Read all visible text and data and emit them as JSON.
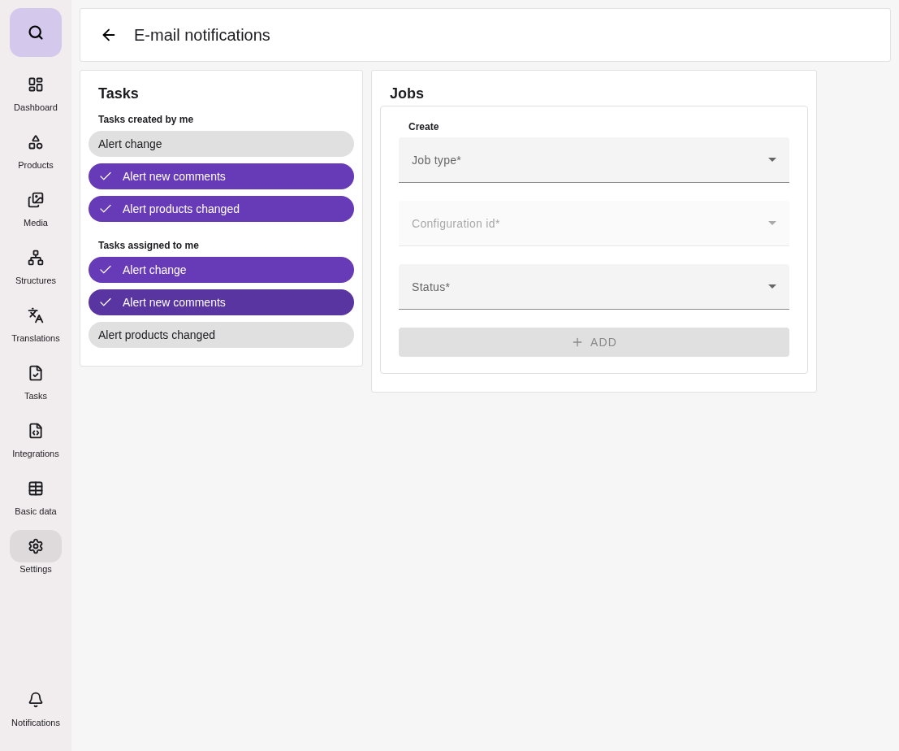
{
  "sidebar": {
    "search_selected": false,
    "items": [
      {
        "kind": "dashboard",
        "label": "Dashboard",
        "selected": false
      },
      {
        "kind": "products",
        "label": "Products",
        "selected": false
      },
      {
        "kind": "media",
        "label": "Media",
        "selected": false
      },
      {
        "kind": "structures",
        "label": "Structures",
        "selected": false
      },
      {
        "kind": "translations",
        "label": "Translations",
        "selected": false
      },
      {
        "kind": "tasks",
        "label": "Tasks",
        "selected": false
      },
      {
        "kind": "integrations",
        "label": "Integrations",
        "selected": false
      },
      {
        "kind": "basic",
        "label": "Basic data",
        "selected": false
      },
      {
        "kind": "settings",
        "label": "Settings",
        "selected": true
      }
    ],
    "bottom": [
      {
        "kind": "notifications",
        "label": "Notifications",
        "selected": false
      }
    ]
  },
  "header": {
    "title": "E-mail notifications"
  },
  "tasks": {
    "title": "Tasks",
    "groups": [
      {
        "title": "Tasks created by me",
        "chips": [
          {
            "label": "Alert change",
            "selected": false,
            "focused": false
          },
          {
            "label": "Alert new comments",
            "selected": true,
            "focused": false
          },
          {
            "label": "Alert products changed",
            "selected": true,
            "focused": false
          }
        ]
      },
      {
        "title": "Tasks assigned to me",
        "chips": [
          {
            "label": "Alert change",
            "selected": true,
            "focused": false
          },
          {
            "label": "Alert new comments",
            "selected": true,
            "focused": true
          },
          {
            "label": "Alert products changed",
            "selected": false,
            "focused": false
          }
        ]
      }
    ]
  },
  "jobs": {
    "title": "Jobs",
    "create": {
      "title": "Create",
      "fields": [
        {
          "label": "Job type",
          "required_mark": "*",
          "disabled": false
        },
        {
          "label": "Configuration id",
          "required_mark": "*",
          "disabled": true
        },
        {
          "label": "Status",
          "required_mark": "*",
          "disabled": false
        }
      ],
      "button": {
        "label": "ADD",
        "disabled": true
      }
    }
  }
}
